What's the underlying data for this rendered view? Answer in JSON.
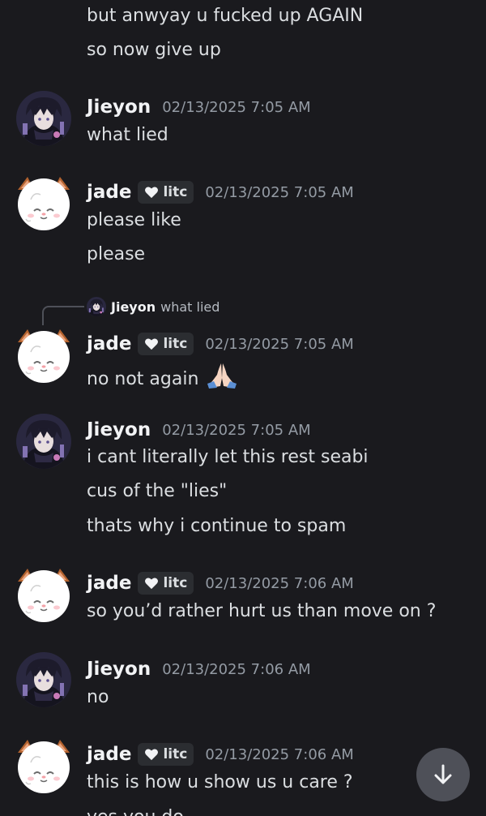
{
  "users": {
    "jieyon": {
      "name": "Jieyon"
    },
    "jade": {
      "name": "jade",
      "tag": "litc"
    }
  },
  "messages": [
    {
      "lines": [
        "but anwyay u fucked up AGAIN",
        "so now give up"
      ]
    },
    {
      "author": "Jieyon",
      "time": "02/13/2025 7:05 AM",
      "lines": [
        "what lied"
      ]
    },
    {
      "author": "jade",
      "tag": "litc",
      "time": "02/13/2025 7:05 AM",
      "lines": [
        "please like",
        "please"
      ]
    },
    {
      "author": "jade",
      "tag": "litc",
      "time": "02/13/2025 7:05 AM",
      "reply": {
        "author": "Jieyon",
        "text": "what lied"
      },
      "lines": [
        "no not again"
      ]
    },
    {
      "author": "Jieyon",
      "time": "02/13/2025 7:05 AM",
      "lines": [
        "i cant literally let this rest seabi",
        "cus of the \"lies\"",
        "thats why i continue to spam"
      ]
    },
    {
      "author": "jade",
      "tag": "litc",
      "time": "02/13/2025 7:06 AM",
      "lines": [
        "so you’d rather hurt us than move on ?"
      ]
    },
    {
      "author": "Jieyon",
      "time": "02/13/2025 7:06 AM",
      "lines": [
        "no"
      ]
    },
    {
      "author": "jade",
      "tag": "litc",
      "time": "02/13/2025 7:06 AM",
      "lines": [
        "this is how u show us u care ?",
        "yes you do"
      ]
    }
  ],
  "icons": {
    "emoji": "folded-hands-icon",
    "tag_icon": "heart-icon",
    "scroll_button": "arrow-down-icon"
  },
  "colors": {
    "background": "#1a1a1e",
    "username": "#f2f3f5",
    "timestamp": "#949ba4",
    "text": "#dbdee1",
    "tag_bg": "#2b2d31",
    "scroll_button": "#4e5058"
  }
}
